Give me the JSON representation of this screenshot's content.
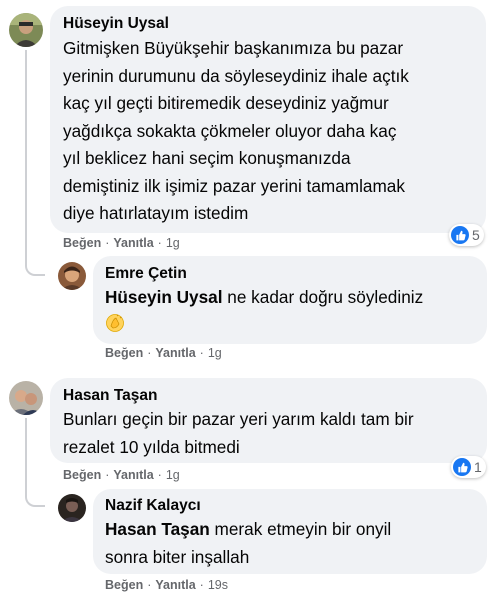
{
  "comments": [
    {
      "author": "Hüseyin Uysal",
      "lines": [
        "Gitmişken Büyükşehir başkanımıza bu pazar",
        "yerinin durumunu da söyleseydiniz ihale açtık",
        "kaç yıl geçti bitiremedik deseydiniz yağmur",
        "yağdıkça sokakta çökmeler oluyor daha kaç",
        "yıl beklicez hani seçim konuşmanızda",
        "demiştiniz ilk işimiz pazar yerini tamamlamak",
        "diye hatırlatayım istedim"
      ],
      "actions": {
        "like": "Beğen",
        "reply": "Yanıtla",
        "time": "1g"
      },
      "reaction_count": "5",
      "reply": {
        "author": "Emre Çetin",
        "mention": "Hüseyin Uysal",
        "text": " ne kadar doğru söylediniz",
        "emoji": "👏",
        "actions": {
          "like": "Beğen",
          "reply": "Yanıtla",
          "time": "1g"
        }
      }
    },
    {
      "author": "Hasan Taşan",
      "lines": [
        "Bunları geçin bir pazar yeri yarım kaldı tam bir",
        "rezalet 10 yılda bitmedi"
      ],
      "actions": {
        "like": "Beğen",
        "reply": "Yanıtla",
        "time": "1g"
      },
      "reaction_count": "1",
      "reply": {
        "author": "Nazif Kalaycı",
        "mention": "Hasan Taşan",
        "text": " merak etmeyin bir onyil",
        "line2": "sonra biter inşallah",
        "actions": {
          "like": "Beğen",
          "reply": "Yanıtla",
          "time": "19s"
        }
      }
    }
  ],
  "separator": "·",
  "colors": {
    "bubble": "#f0f2f5",
    "secondary_text": "#65676b",
    "like_blue": "#1877f2"
  }
}
